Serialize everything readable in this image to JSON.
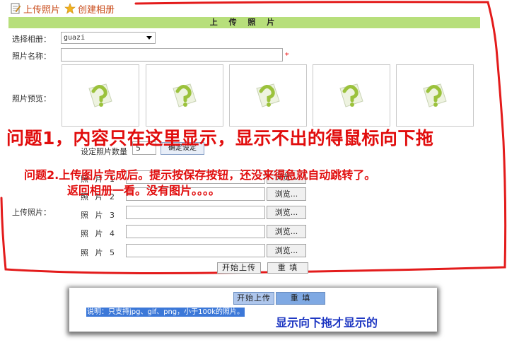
{
  "toolbar": {
    "upload_link": "上传照片",
    "create_album_link": "创建相册"
  },
  "form": {
    "title": "上 传 照 片",
    "album_label": "选择相册：",
    "album_selected": "guazi",
    "name_label": "照片名称：",
    "required_mark": "*",
    "preview_label": "照片预览：",
    "count_label": "设定照片数量",
    "count_value": "5",
    "set_button": "确定设定",
    "upload_label": "上传照片：",
    "rows": [
      {
        "label": "照 片 1",
        "browse": "浏览..."
      },
      {
        "label": "照 片 2",
        "browse": "浏览..."
      },
      {
        "label": "照 片 3",
        "browse": "浏览..."
      },
      {
        "label": "照 片 4",
        "browse": "浏览..."
      },
      {
        "label": "照 片 5",
        "browse": "浏览..."
      }
    ],
    "start_upload_button": "开始上传",
    "reset_button": "重 填"
  },
  "annotations": {
    "question1": "问题1，内容只在这里显示，显示不出的得鼠标向下拖",
    "question2_line1": "问题2.上传图片完成后。提示按保存按钮，还没来得急就自动跳转了。",
    "question2_line2": "返回相册一看。没有图片。。。。",
    "panel_note": "显示向下拖才显示的"
  },
  "panel2": {
    "start_upload_button": "开始上传",
    "reset_button": "重 填",
    "info_text": "说明：只支持jpg、gif、png，小于100k的照片。"
  },
  "colors": {
    "title_bar": "#b7df7b",
    "annotation_red": "#e10d0d",
    "link_orange": "#c94a18",
    "annotation_blue": "#1d36c2"
  },
  "icons": [
    "upload-photo-icon",
    "star-icon",
    "question-image-icon",
    "dropdown-arrow-icon"
  ]
}
